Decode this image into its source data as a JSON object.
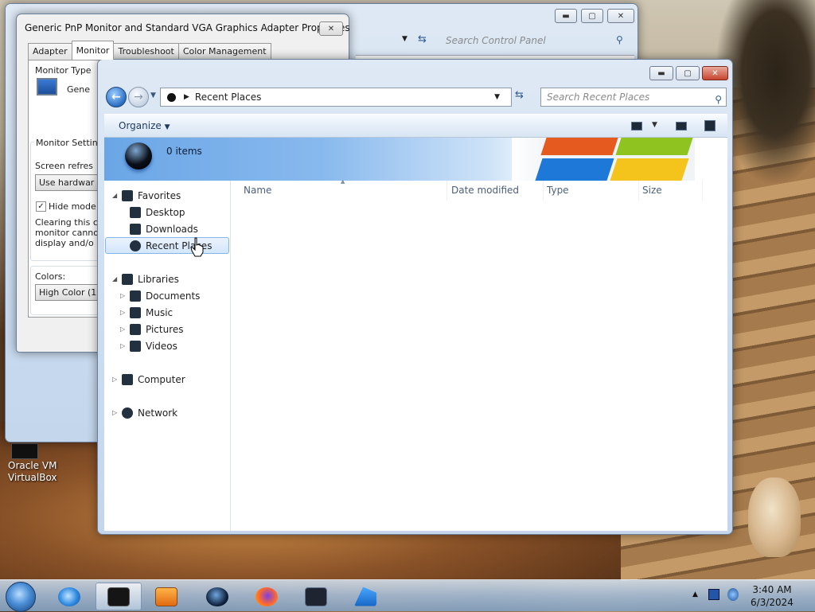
{
  "desktop": {
    "virtualbox_label": "Oracle VM VirtualBox"
  },
  "control_panel": {
    "search_placeholder": "Search Control Panel"
  },
  "dialog": {
    "title": "Generic PnP Monitor and Standard VGA Graphics Adapter Properties",
    "close_label": "✕",
    "tabs": [
      "Adapter",
      "Monitor",
      "Troubleshoot",
      "Color Management"
    ],
    "active_tab": "Monitor",
    "monitor_type_label": "Monitor Type",
    "monitor_name": "Gene",
    "monitor_settings_label": "Monitor Settin",
    "screen_refresh_label": "Screen refres",
    "refresh_value": "Use hardwar",
    "hide_modes_label": "Hide mode",
    "hide_modes_checked": true,
    "clearing_text_1": "Clearing this c",
    "clearing_text_2": "monitor canno",
    "clearing_text_3": "display and/o",
    "colors_label": "Colors:",
    "colors_value": "High Color (1"
  },
  "explorer": {
    "address": "Recent Places",
    "search_placeholder": "Search Recent Places",
    "organize_label": "Organize",
    "items_count": "0 items",
    "nav": {
      "favorites": "Favorites",
      "desktop": "Desktop",
      "downloads": "Downloads",
      "recent_places": "Recent Places",
      "libraries": "Libraries",
      "documents": "Documents",
      "music": "Music",
      "pictures": "Pictures",
      "videos": "Videos",
      "computer": "Computer",
      "network": "Network"
    },
    "columns": [
      "Name",
      "Date modified",
      "Type",
      "Size"
    ]
  },
  "taskbar": {
    "time": "3:40 AM",
    "date": "6/3/2024"
  }
}
